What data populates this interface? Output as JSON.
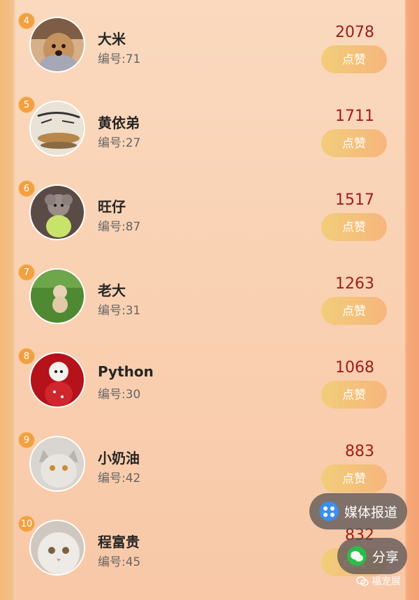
{
  "list": [
    {
      "rank": "4",
      "name": "大米",
      "number": "编号:71",
      "votes": "2078",
      "like": "点赞"
    },
    {
      "rank": "5",
      "name": "黄依弟",
      "number": "编号:27",
      "votes": "1711",
      "like": "点赞"
    },
    {
      "rank": "6",
      "name": "旺仔",
      "number": "编号:87",
      "votes": "1517",
      "like": "点赞"
    },
    {
      "rank": "7",
      "name": "老大",
      "number": "编号:31",
      "votes": "1263",
      "like": "点赞"
    },
    {
      "rank": "8",
      "name": "Python",
      "number": "编号:30",
      "votes": "1068",
      "like": "点赞"
    },
    {
      "rank": "9",
      "name": "小奶油",
      "number": "编号:42",
      "votes": "883",
      "like": "点赞"
    },
    {
      "rank": "10",
      "name": "程富贵",
      "number": "编号:45",
      "votes": "832",
      "like": "点赞"
    }
  ],
  "floating": {
    "media": "媒体报道",
    "share": "分享"
  },
  "watermark": "福宠展",
  "colors": {
    "accent": "#f2a040",
    "votes": "#9e1c1c",
    "like_button": "#f1cd79"
  }
}
